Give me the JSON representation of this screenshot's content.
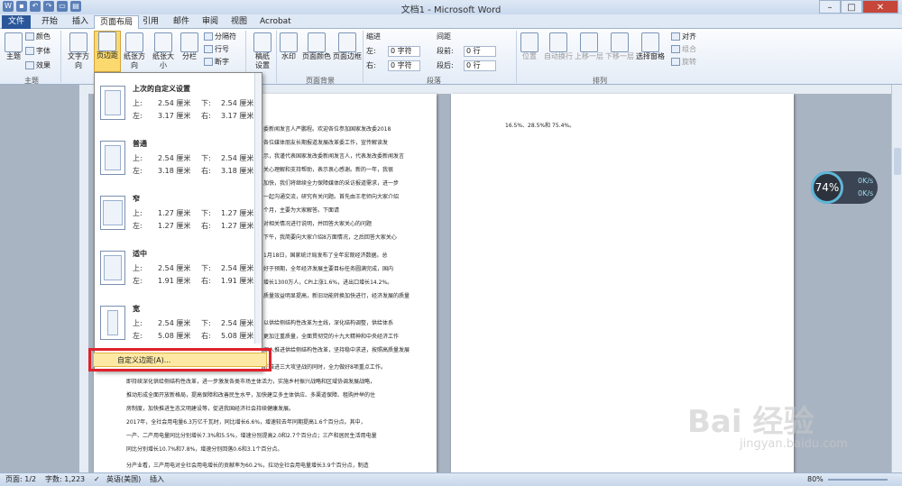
{
  "title": "文档1 - Microsoft Word",
  "tabs": [
    "文件",
    "开始",
    "插入",
    "页面布局",
    "引用",
    "邮件",
    "审阅",
    "视图",
    "Acrobat"
  ],
  "ribbon": {
    "theme": {
      "main": "主题",
      "color": "颜色",
      "font": "字体",
      "effect": "效果",
      "group": "主题"
    },
    "page_setup": {
      "direction": "文字方向",
      "margins": "页边距",
      "orientation": "纸张方向",
      "size": "纸张大小",
      "columns": "分栏",
      "breaks": "分隔符",
      "line_numbers": "行号",
      "hyphen": "断字",
      "group": "页面设置"
    },
    "manuscript": {
      "label": "稿纸\n设置",
      "group": "稿纸"
    },
    "background": {
      "watermark": "水印",
      "page_color": "页面颜色",
      "page_border": "页面边框",
      "group": "页面背景"
    },
    "indent": {
      "label": "缩进",
      "left": "左:",
      "left_val": "0 字符",
      "right": "右:",
      "right_val": "0 字符"
    },
    "spacing": {
      "label": "间距",
      "before": "段前:",
      "before_val": "0 行",
      "after": "段后:",
      "after_val": "0 行"
    },
    "paragraph_group": "段落",
    "arrange": {
      "position": "位置",
      "wrap": "自动换行",
      "forward": "上移一层",
      "backward": "下移一层",
      "select": "选择窗格",
      "align": "对齐",
      "group_btn": "组合",
      "rotate": "旋转",
      "group": "排列"
    }
  },
  "margins_menu": [
    {
      "title": "上次的自定义设置",
      "top": "2.54 厘米",
      "bottom": "2.54 厘米",
      "left": "3.17 厘米",
      "right": "3.17 厘米"
    },
    {
      "title": "普通",
      "top": "2.54 厘米",
      "bottom": "2.54 厘米",
      "left": "3.18 厘米",
      "right": "3.18 厘米"
    },
    {
      "title": "窄",
      "top": "1.27 厘米",
      "bottom": "1.27 厘米",
      "left": "1.27 厘米",
      "right": "1.27 厘米"
    },
    {
      "title": "适中",
      "top": "2.54 厘米",
      "bottom": "2.54 厘米",
      "left": "1.91 厘米",
      "right": "1.91 厘米"
    },
    {
      "title": "宽",
      "top": "2.54 厘米",
      "bottom": "2.54 厘米",
      "left": "5.08 厘米",
      "right": "5.08 厘米"
    }
  ],
  "margin_labels": {
    "top": "上:",
    "bottom": "下:",
    "left": "左:",
    "right": "右:"
  },
  "custom_margins": "自定义边距(A)...",
  "doc_lines": [
    "委新闻发言人严鹏程。欢迎各位参加国家发改委2018",
    "各位媒体朋友长期报道发展改革委工作，宣传解读发",
    "示，我谨代表国家发改委新闻发言人，代表发改委新闻发言",
    "关心理解和支持帮助，表示衷心感谢。新的一年，我很",
    "加快，我们将继续全力保障媒体的采访报道需求，进一步",
    "一起沟通交流，研究有关问题。首先由王老师向大家介绍",
    "个月，主要为大家解答。下面请",
    "对相关情况进行说明，并回答大家关心的问题",
    "下午，我简要向大家介绍8方面情况，之后回答大家关心",
    "1月18日，国家统计局发布了全年宏观经济数据。总",
    "好于预期，全年经济发展主要目标任务圆满完成，国内",
    "增长1300万人，CPI上涨1.6%，进出口增长14.2%。",
    "质量效益明显提高，新旧动能转换加快进行，经济发展的质量",
    "以供给侧结构性改革为主线，深化结构调整，供给体系",
    "更加注重质量，全面贯彻党的十九大精神和中央经济工作",
    "深入推进供给侧结构性改革，坚持稳中求进，按照高质量发展",
    "在推进三大攻坚战的同时，全力做好8项重点工作。",
    "即持续深化供给侧结构性改革，进一步激发各类市场主体活力，实施乡村振兴战略和区域协调发展战略，",
    "推动形成全面开放新格局，提高保障和改善民生水平，加快建立多主体供应、多渠道保障、租购并举的住",
    "房制度，加快推进生态文明建设等，促进我国经济社会持续健康发展。",
    "2017年，全社会用电量6.3万亿千瓦时，同比增长6.6%，增速较去年同期提高1.6个百分点。其中，",
    "一产、二产用电量同比分别增长7.3%和5.5%，增速分别提高2.0和2.7个百分点；三产和居民生活用电量",
    "同比分别增长10.7%和7.8%，增速分别回落0.6和3.1个百分点。",
    "分产业看，三产用电对全社会用电增长的贡献率为60.2%，拉动全社会用电量增长3.9个百分点，制造"
  ],
  "page2_line": "16.5%、28.5%和 75.4%。",
  "widget": {
    "percent": "74%",
    "up": "0K/s",
    "down": "0K/s"
  },
  "status": {
    "page": "页面: 1/2",
    "words": "字数: 1,223",
    "lang": "英语(美国)",
    "insert": "插入",
    "zoom": "80%"
  },
  "watermark": {
    "main": "Bai 经验",
    "url": "jingyan.baidu.com"
  }
}
